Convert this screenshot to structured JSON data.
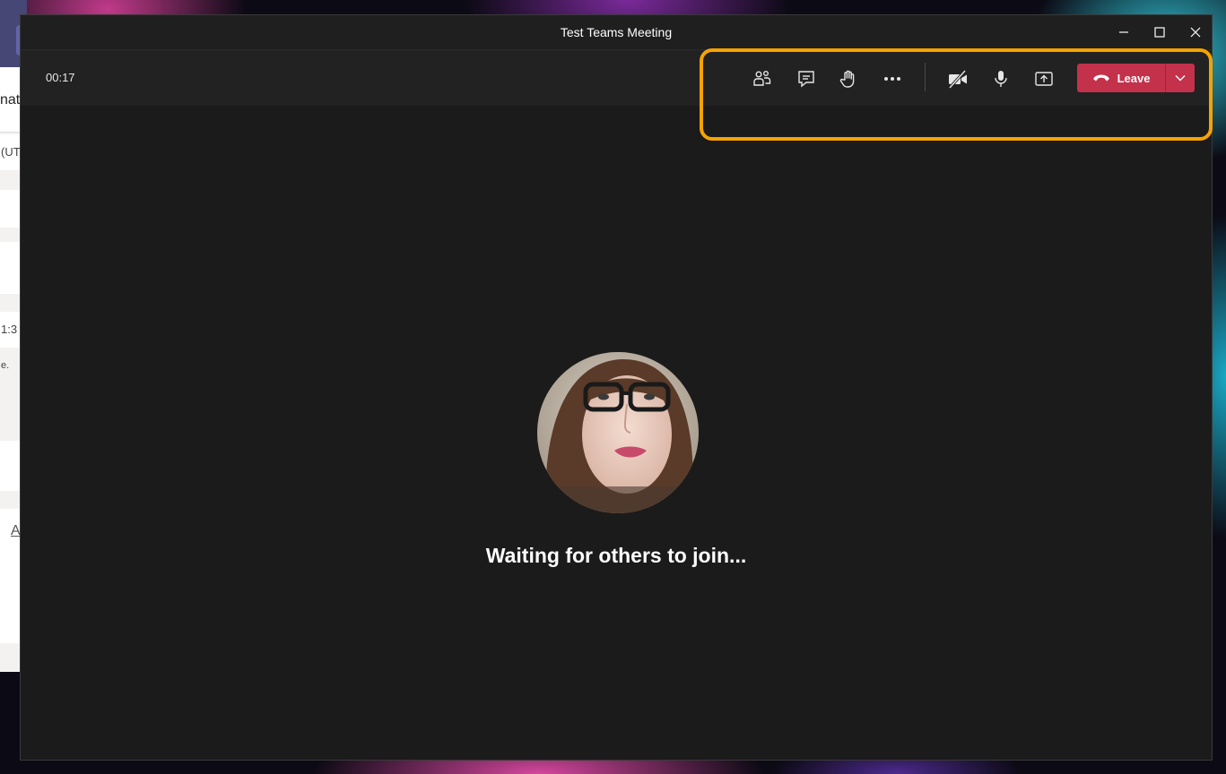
{
  "window": {
    "title": "Test Teams Meeting"
  },
  "toolbar": {
    "timer": "00:17",
    "leave_label": "Leave",
    "leave_color": "#c4314b",
    "icons": [
      "participants-icon",
      "chat-icon",
      "raise-hand-icon",
      "more-options-icon",
      "camera-off-icon",
      "microphone-icon",
      "share-screen-icon",
      "hang-up-icon",
      "chevron-down-icon"
    ]
  },
  "stage": {
    "status": "Waiting for others to join..."
  },
  "background_app": {
    "header_fragment": "nat",
    "fragment_1": "(UT",
    "fragment_2": "1:3",
    "fragment_3": "e.",
    "fragment_4": "A"
  },
  "highlight_color": "#f5a300"
}
